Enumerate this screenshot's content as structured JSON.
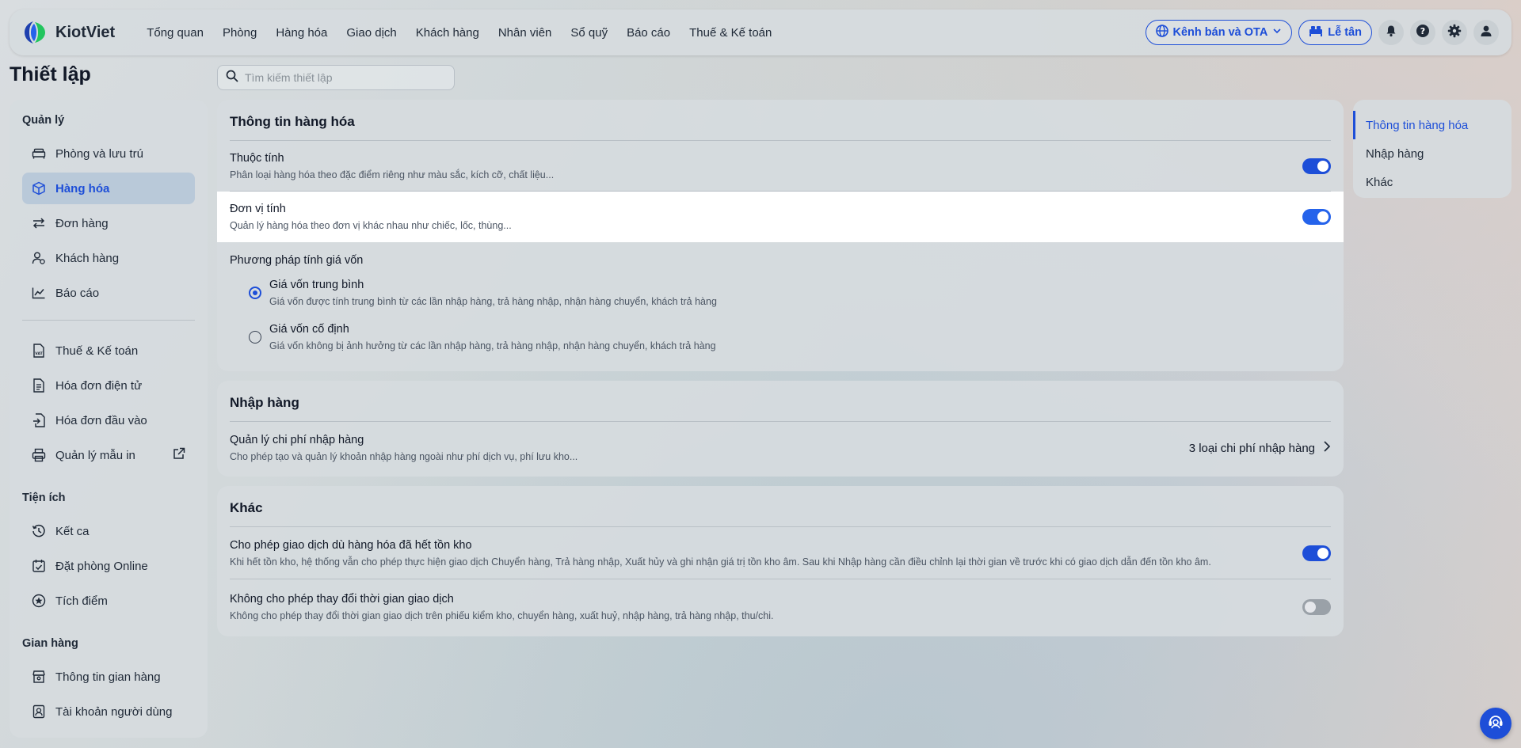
{
  "brand": {
    "name": "KiotViet"
  },
  "nav": {
    "items": [
      "Tổng quan",
      "Phòng",
      "Hàng hóa",
      "Giao dịch",
      "Khách hàng",
      "Nhân viên",
      "Sổ quỹ",
      "Báo cáo",
      "Thuế & Kế toán"
    ]
  },
  "topbar": {
    "channel_label": "Kênh bán và OTA",
    "reception_label": "Lễ tân"
  },
  "page": {
    "title": "Thiết lập",
    "search_placeholder": "Tìm kiếm thiết lập"
  },
  "sidebar": {
    "groups": [
      {
        "title": "Quản lý",
        "items": [
          "Phòng và lưu trú",
          "Hàng hóa",
          "Đơn hàng",
          "Khách hàng",
          "Báo cáo"
        ]
      },
      {
        "items": [
          "Thuế & Kế toán",
          "Hóa đơn điện tử",
          "Hóa đơn đầu vào",
          "Quản lý mẫu in"
        ]
      },
      {
        "title": "Tiện ích",
        "items": [
          "Kết ca",
          "Đặt phòng Online",
          "Tích điểm"
        ]
      },
      {
        "title": "Gian hàng",
        "items": [
          "Thông tin gian hàng",
          "Tài khoản người dùng"
        ]
      }
    ],
    "active_item": "Hàng hóa"
  },
  "sections": {
    "product_info": {
      "title": "Thông tin hàng hóa",
      "attributes": {
        "title": "Thuộc tính",
        "desc": "Phân loại hàng hóa theo đặc điểm riêng như màu sắc, kích cỡ, chất liệu...",
        "enabled": true
      },
      "units": {
        "title": "Đơn vị tính",
        "desc": "Quản lý hàng hóa theo đơn vị khác nhau như chiếc, lốc, thùng...",
        "enabled": true
      },
      "cost_method": {
        "title": "Phương pháp tính giá vốn",
        "options": [
          {
            "title": "Giá vốn trung bình",
            "desc": "Giá vốn được tính trung bình từ các lần nhập hàng, trả hàng nhập, nhận hàng chuyển, khách trả hàng",
            "selected": true
          },
          {
            "title": "Giá vốn cố định",
            "desc": "Giá vốn không bị ảnh hưởng từ các lần nhập hàng, trả hàng nhập, nhận hàng chuyển, khách trả hàng",
            "selected": false
          }
        ]
      }
    },
    "import": {
      "title": "Nhập hàng",
      "cost_mgmt": {
        "title": "Quản lý chi phí nhập hàng",
        "desc": "Cho phép tạo và quản lý khoản nhập hàng ngoài như phí dịch vụ, phí lưu kho...",
        "value": "3 loại chi phí nhập hàng"
      }
    },
    "other": {
      "title": "Khác",
      "allow_out_of_stock": {
        "title": "Cho phép giao dịch dù hàng hóa đã hết tồn kho",
        "desc": "Khi hết tồn kho, hệ thống vẫn cho phép thực hiện giao dịch Chuyển hàng, Trả hàng nhập, Xuất hủy và ghi nhận giá trị tồn kho âm. Sau khi Nhập hàng cần điều chỉnh lại thời gian về trước khi có giao dịch dẫn đến tồn kho âm.",
        "enabled": true
      },
      "lock_time": {
        "title": "Không cho phép thay đổi thời gian giao dịch",
        "desc": "Không cho phép thay đổi thời gian giao dịch trên phiếu kiểm kho, chuyển hàng, xuất huỷ, nhập hàng, trả hàng nhập, thu/chi.",
        "enabled": false
      }
    }
  },
  "rightnav": {
    "items": [
      "Thông tin hàng hóa",
      "Nhập hàng",
      "Khác"
    ],
    "active": "Thông tin hàng hóa"
  },
  "colors": {
    "accent": "#1d4ed8",
    "panel": "#d6dbde",
    "highlight_row": "#ffffff"
  }
}
